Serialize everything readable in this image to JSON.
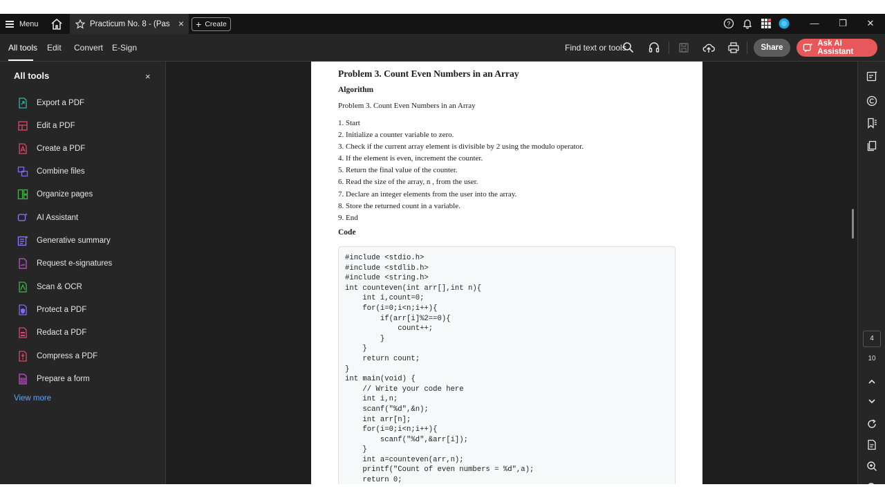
{
  "titlebar": {
    "menu_label": "Menu",
    "tab_title": "Practicum No. 8 - (Passi...",
    "tab_close": "×",
    "create_label": "Create",
    "icons": [
      "help-icon",
      "bell-icon",
      "apps-grid-icon",
      "profile-icon"
    ],
    "window_controls": {
      "minimize": "—",
      "restore": "❐",
      "close": "✕"
    }
  },
  "toolbar": {
    "tabs": [
      "All tools",
      "Edit",
      "Convert",
      "E-Sign"
    ],
    "find_label": "Find text or tools",
    "share_label": "Share",
    "ai_label": "Ask AI Assistant",
    "ai_color": "#e8585b"
  },
  "left_panel": {
    "title": "All tools",
    "close": "×",
    "tools": [
      {
        "label": "Export a PDF",
        "icon": "export-pdf-icon",
        "color": "#2fb5a3"
      },
      {
        "label": "Edit a PDF",
        "icon": "edit-pdf-icon",
        "color": "#e0466a"
      },
      {
        "label": "Create a PDF",
        "icon": "create-pdf-icon",
        "color": "#e0466a"
      },
      {
        "label": "Combine files",
        "icon": "combine-files-icon",
        "color": "#7b6cf6"
      },
      {
        "label": "Organize pages",
        "icon": "organize-pages-icon",
        "color": "#43b64a"
      },
      {
        "label": "AI Assistant",
        "icon": "ai-assistant-icon",
        "color": "#8d7cf8"
      },
      {
        "label": "Generative summary",
        "icon": "generative-summary-icon",
        "color": "#8d7cf8"
      },
      {
        "label": "Request e-signatures",
        "icon": "request-esign-icon",
        "color": "#c24fd0"
      },
      {
        "label": "Scan & OCR",
        "icon": "scan-ocr-icon",
        "color": "#43b64a"
      },
      {
        "label": "Protect a PDF",
        "icon": "protect-pdf-icon",
        "color": "#7b6cf6"
      },
      {
        "label": "Redact a PDF",
        "icon": "redact-pdf-icon",
        "color": "#e0466a"
      },
      {
        "label": "Compress a PDF",
        "icon": "compress-pdf-icon",
        "color": "#e0466a"
      },
      {
        "label": "Prepare a form",
        "icon": "prepare-form-icon",
        "color": "#c24fd0"
      }
    ],
    "view_more": "View more"
  },
  "document": {
    "heading": "Problem 3. Count Even Numbers in an Array",
    "algorithm_label": "Algorithm",
    "algorithm_intro": "Problem 3. Count Even Numbers in an Array",
    "steps": [
      "1. Start",
      "2. Initialize a counter variable to zero.",
      "3. Check if the current array element is divisible by 2 using the modulo operator.",
      "4. If the element is even, increment the counter.",
      "5. Return the final value of the counter.",
      "6. Read the size of the array, n , from the user.",
      "7. Declare an integer elements from the user into the array.",
      "8. Store the returned count in a variable.",
      "9. End"
    ],
    "code_label": "Code",
    "code": "#include <stdio.h>\n#include <stdlib.h>\n#include <string.h>\nint counteven(int arr[],int n){\n    int i,count=0;\n    for(i=0;i<n;i++){\n        if(arr[i]%2==0){\n            count++;\n        }\n    }\n    return count;\n}\nint main(void) {\n    // Write your code here\n    int i,n;\n    scanf(\"%d\",&n);\n    int arr[n];\n    for(i=0;i<n;i++){\n        scanf(\"%d\",&arr[i]);\n    }\n    int a=counteven(arr,n);\n    printf(\"Count of even numbers = %d\",a);\n    return 0;"
  },
  "right_rail": {
    "current_page": "4",
    "total_pages": "10"
  }
}
